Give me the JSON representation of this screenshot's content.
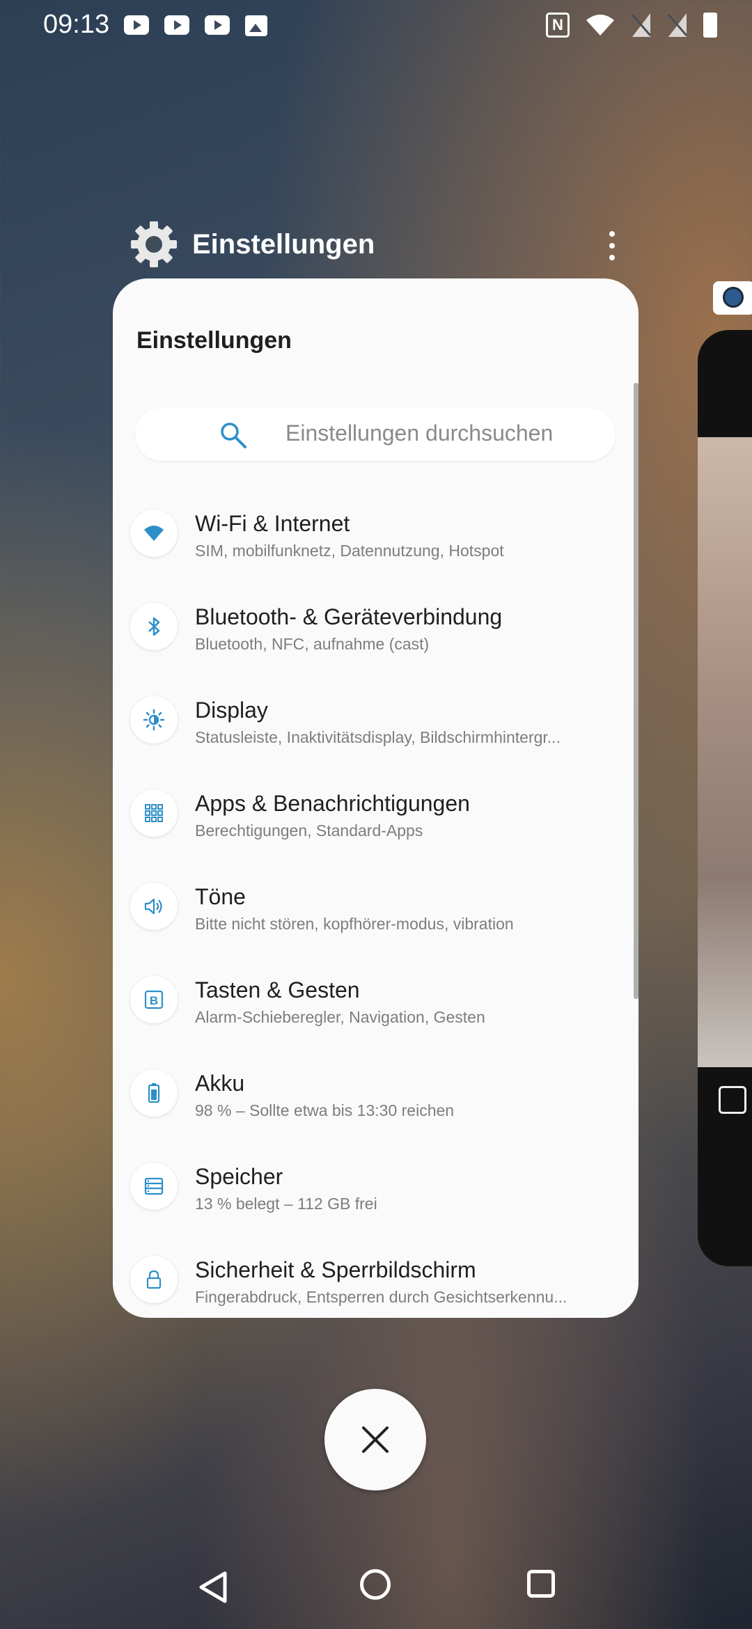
{
  "status_bar": {
    "time": "09:13",
    "left_icons": [
      "youtube-icon",
      "youtube-icon",
      "youtube-icon",
      "gallery-icon"
    ],
    "right_icons": [
      "nfc-icon",
      "wifi-icon",
      "no-sim-icon",
      "no-sim-icon",
      "battery-icon"
    ],
    "nfc_glyph": "N"
  },
  "recent_app": {
    "title": "Einstellungen",
    "icon": "gear-icon"
  },
  "settings_card": {
    "title": "Einstellungen",
    "search_placeholder": "Einstellungen durchsuchen",
    "items": [
      {
        "title": "Wi-Fi & Internet",
        "subtitle": "SIM, mobilfunknetz, Datennutzung, Hotspot",
        "icon": "wifi-icon"
      },
      {
        "title": "Bluetooth- & Geräteverbindung",
        "subtitle": "Bluetooth, NFC, aufnahme (cast)",
        "icon": "bluetooth-icon"
      },
      {
        "title": "Display",
        "subtitle": "Statusleiste, Inaktivitätsdisplay, Bildschirmhintergr...",
        "icon": "brightness-icon"
      },
      {
        "title": "Apps & Benachrichtigungen",
        "subtitle": "Berechtigungen, Standard-Apps",
        "icon": "apps-grid-icon"
      },
      {
        "title": "Töne",
        "subtitle": "Bitte nicht stören, kopfhörer-modus, vibration",
        "icon": "speaker-icon"
      },
      {
        "title": "Tasten & Gesten",
        "subtitle": "Alarm-Schieberegler, Navigation, Gesten",
        "icon": "buttons-icon"
      },
      {
        "title": "Akku",
        "subtitle": "98 % – Sollte etwa bis 13:30 reichen",
        "icon": "battery-icon"
      },
      {
        "title": "Speicher",
        "subtitle": "13 % belegt – 112 GB frei",
        "icon": "storage-icon"
      },
      {
        "title": "Sicherheit & Sperrbildschirm",
        "subtitle": "Fingerabdruck, Entsperren durch Gesichtserkennu...",
        "icon": "lock-icon"
      }
    ]
  },
  "accent_color": "#2d8fc7",
  "navigation": [
    "back-icon",
    "home-icon",
    "recents-icon"
  ]
}
